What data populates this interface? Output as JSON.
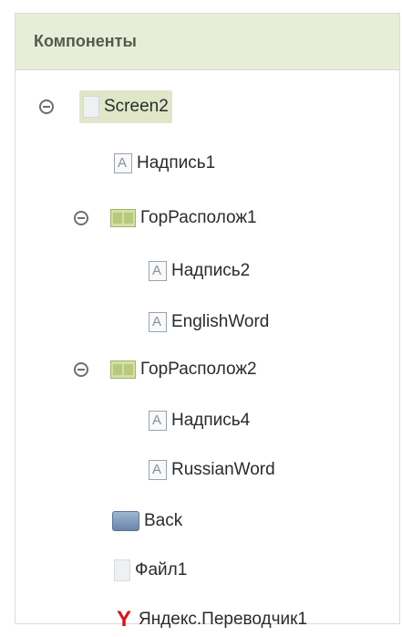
{
  "panel": {
    "title": "Компоненты"
  },
  "tree": [
    {
      "id": "screen2",
      "label": "Screen2",
      "icon": "screen-icon",
      "toggle": true,
      "selected": true
    },
    {
      "id": "label1",
      "label": "Надпись1",
      "icon": "label-icon"
    },
    {
      "id": "hbox1",
      "label": "ГорРасполож1",
      "icon": "horizontal-arrangement-icon",
      "toggle": true
    },
    {
      "id": "label2",
      "label": "Надпись2",
      "icon": "label-icon"
    },
    {
      "id": "englishword",
      "label": "EnglishWord",
      "icon": "label-icon"
    },
    {
      "id": "hbox2",
      "label": "ГорРасполож2",
      "icon": "horizontal-arrangement-icon",
      "toggle": true
    },
    {
      "id": "label4",
      "label": "Надпись4",
      "icon": "label-icon"
    },
    {
      "id": "russianword",
      "label": "RussianWord",
      "icon": "label-icon"
    },
    {
      "id": "back",
      "label": "Back",
      "icon": "button-icon"
    },
    {
      "id": "file1",
      "label": "Файл1",
      "icon": "file-icon"
    },
    {
      "id": "yandex",
      "label": "Яндекс.Переводчик1",
      "icon": "yandex-translate-icon"
    }
  ],
  "colors": {
    "header_bg": "#e7eed8",
    "selected_bg": "#dfe7c8",
    "yandex_red": "#e01010"
  }
}
